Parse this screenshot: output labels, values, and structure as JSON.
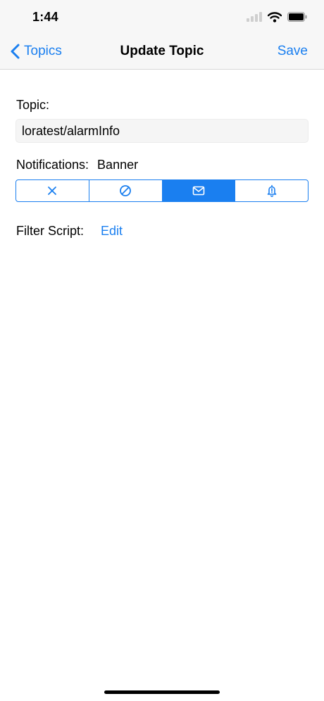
{
  "status_bar": {
    "time": "1:44"
  },
  "nav": {
    "back_label": "Topics",
    "title": "Update Topic",
    "save_label": "Save"
  },
  "topic": {
    "label": "Topic:",
    "value": "loratest/alarmInfo"
  },
  "notifications": {
    "label": "Notifications:",
    "value": "Banner",
    "options": [
      {
        "icon": "x-icon",
        "selected": false
      },
      {
        "icon": "no-entry-icon",
        "selected": false
      },
      {
        "icon": "envelope-icon",
        "selected": true
      },
      {
        "icon": "bell-alert-icon",
        "selected": false
      }
    ]
  },
  "filter": {
    "label": "Filter Script:",
    "edit_label": "Edit"
  },
  "colors": {
    "accent": "#1a7ff0",
    "bar_background": "#f7f7f7"
  }
}
